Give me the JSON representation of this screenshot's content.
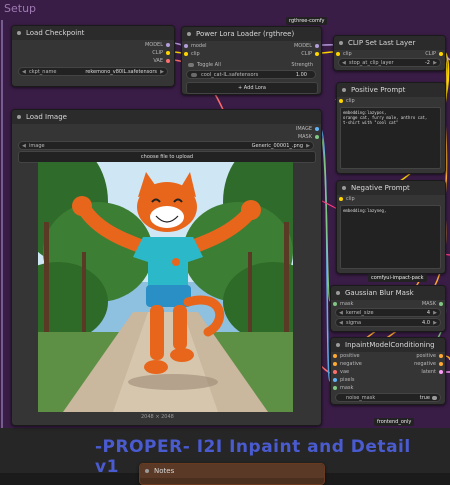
{
  "group": {
    "title": "Setup"
  },
  "load_checkpoint": {
    "title": "Load Checkpoint",
    "outputs": [
      "MODEL",
      "CLIP",
      "VAE"
    ],
    "ckpt_label": "ckpt_name",
    "ckpt_value": "rekemono_v80IL.safetensors"
  },
  "lora_loader": {
    "tag": "rgthree-comfy",
    "title": "Power Lora Loader (rgthree)",
    "inputs": [
      "model",
      "clip"
    ],
    "outputs": [
      "MODEL",
      "CLIP"
    ],
    "toggle_all": "Toggle All",
    "strength_label": "Strength",
    "lora_name": "cool_cat-IL.safetensors",
    "lora_strength": "1.00",
    "add_lora": "+ Add Lora"
  },
  "clip_set_last_layer": {
    "title": "CLIP Set Last Layer",
    "input": "clip",
    "output": "CLIP",
    "widget_label": "stop_at_clip_layer",
    "widget_value": "-2"
  },
  "positive_prompt": {
    "title": "Positive Prompt",
    "input": "clip",
    "text": "embedding:lazypos,\norange cat, furry male, anthro cat,\nt-shirt with \"cool cat\""
  },
  "negative_prompt": {
    "title": "Negative Prompt",
    "input": "clip",
    "text": "embedding:lazyneg,"
  },
  "load_image": {
    "title": "Load Image",
    "outputs": [
      "IMAGE",
      "MASK"
    ],
    "image_label": "image",
    "image_value": "Generic_00001_.png",
    "upload_label": "choose file to upload",
    "dimensions": "2048 × 2048"
  },
  "impact_tag": "comfyui-impact-pack",
  "gaussian_blur": {
    "title": "Gaussian Blur Mask",
    "input": "mask",
    "output": "MASK",
    "kernel_label": "kernel_size",
    "kernel_value": "4",
    "sigma_label": "sigma",
    "sigma_value": "4.0"
  },
  "inpaint_cond": {
    "title": "InpaintModelConditioning",
    "inputs": [
      "positive",
      "negative",
      "vae",
      "pixels",
      "mask"
    ],
    "outputs": [
      "positive",
      "negative",
      "latent"
    ],
    "noise_mask_label": "noise_mask",
    "noise_mask_value": "true"
  },
  "frontend_tag": "frontend_only",
  "banner": "-PROPER- I2I Inpaint and Detail v1",
  "bottom_node_title": "Notes",
  "colors": {
    "model": "#b39ddb",
    "clip": "#ffd500",
    "vae": "#ff6e6e",
    "image": "#64b5f6",
    "mask": "#81c784",
    "conditioning": "#ffa931",
    "latent": "#ff9cf9",
    "banner": "#4a5bd0"
  }
}
